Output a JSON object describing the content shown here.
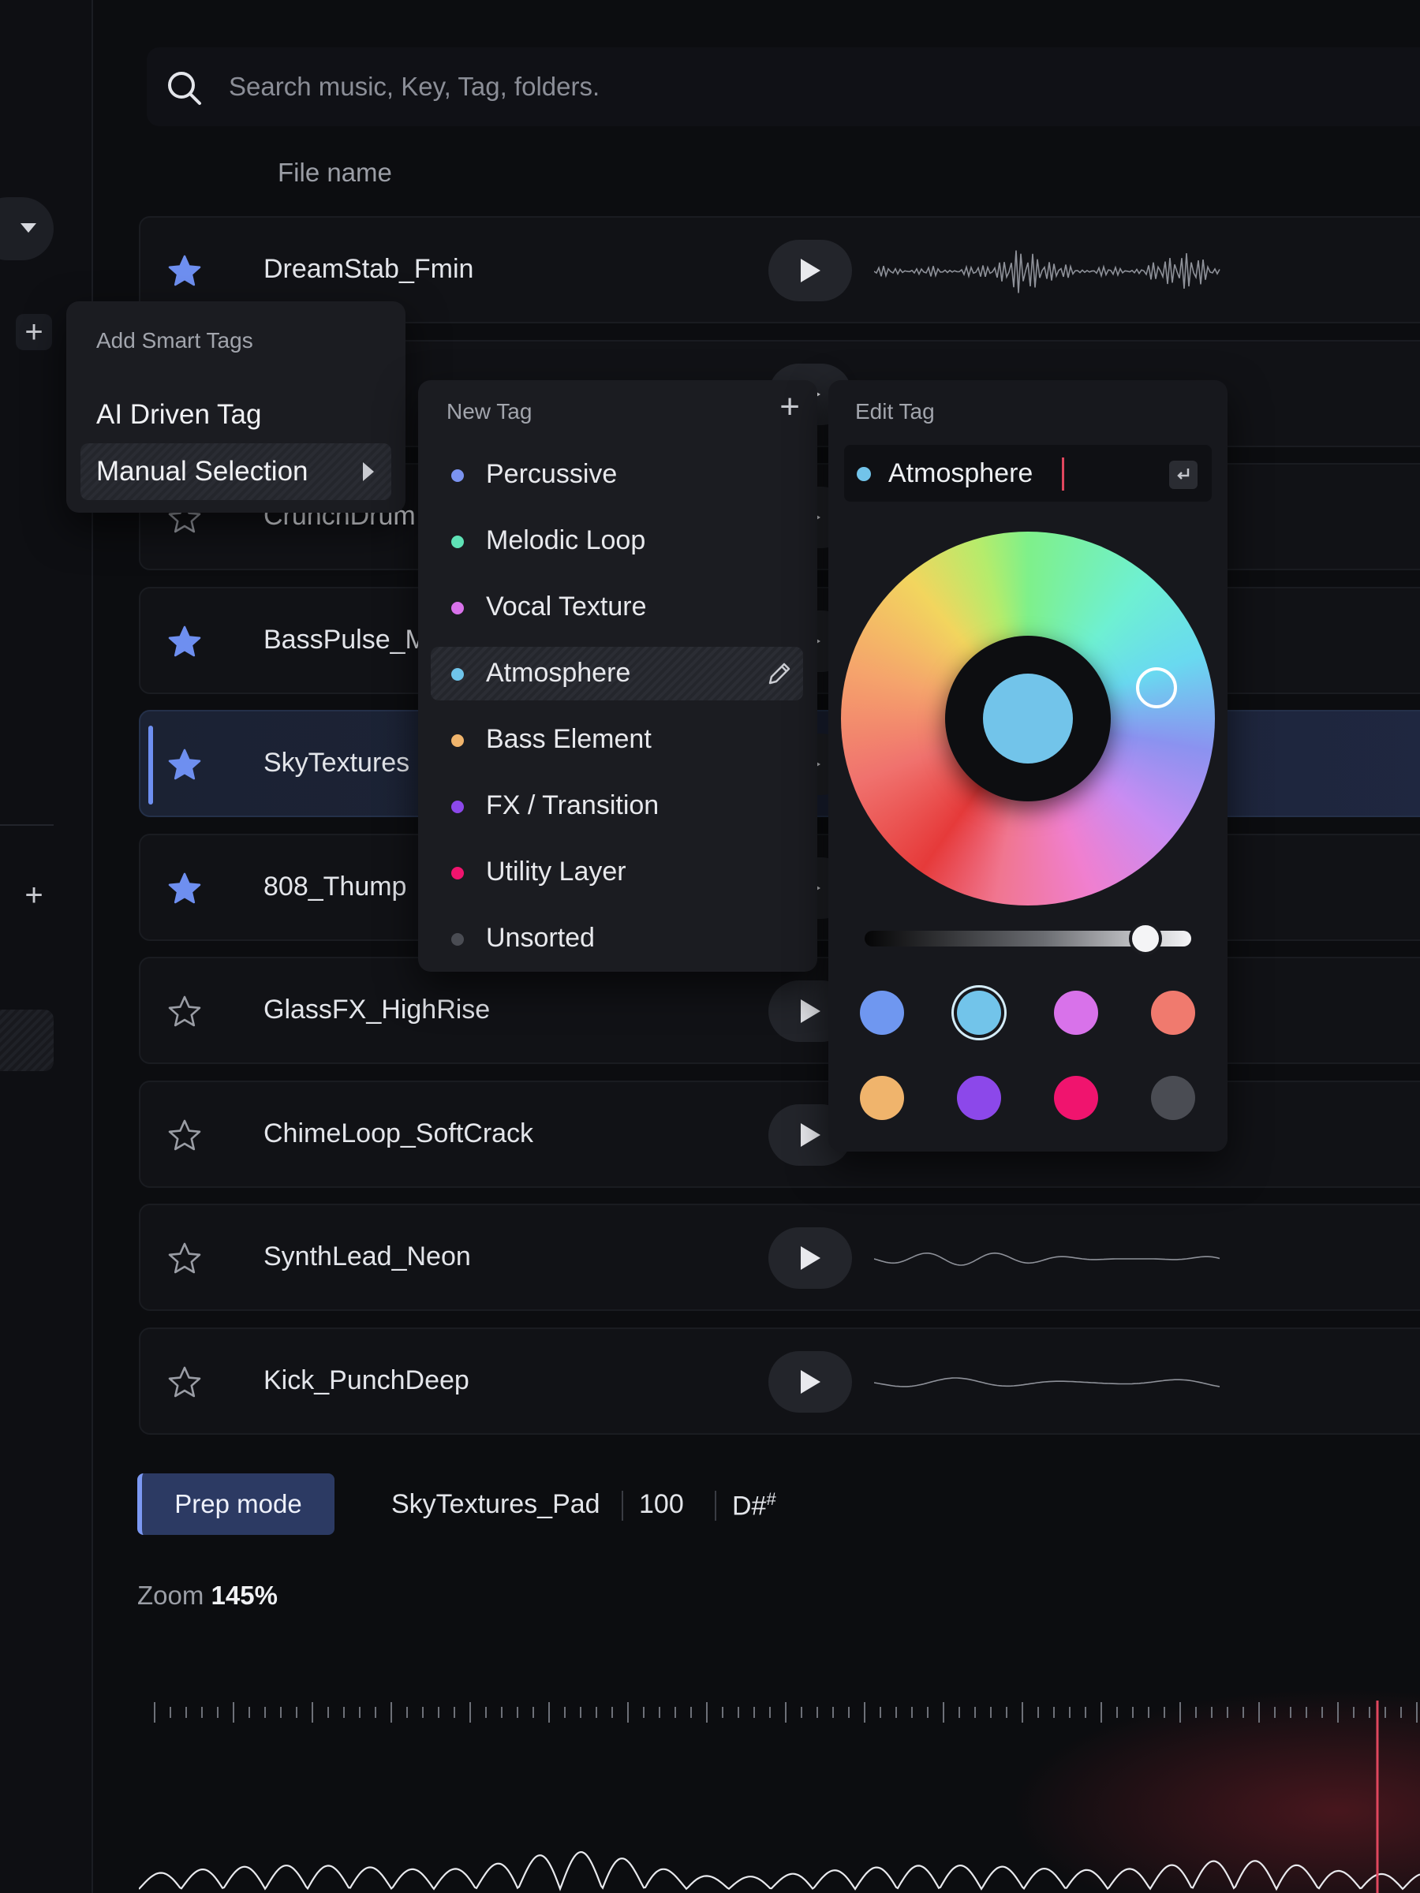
{
  "search": {
    "placeholder": "Search music, Key, Tag, folders."
  },
  "list": {
    "column_file_name": "File name",
    "rows": [
      {
        "name": "DreamStab_Fmin",
        "starred": true
      },
      {
        "name": "",
        "starred": false
      },
      {
        "name": "CrunchDrum",
        "starred": false
      },
      {
        "name": "BassPulse_M",
        "starred": true
      },
      {
        "name": "SkyTextures",
        "starred": true,
        "selected": true
      },
      {
        "name": "808_Thump",
        "starred": true
      },
      {
        "name": "GlassFX_HighRise",
        "starred": false
      },
      {
        "name": "ChimeLoop_SoftCrack",
        "starred": false
      },
      {
        "name": "SynthLead_Neon",
        "starred": false
      },
      {
        "name": "Kick_PunchDeep",
        "starred": false
      }
    ]
  },
  "smart_tags": {
    "title": "Add Smart Tags",
    "option_ai": "AI Driven Tag",
    "option_manual": "Manual Selection"
  },
  "new_tag": {
    "title": "New Tag",
    "items": [
      {
        "label": "Percussive",
        "color": "#7b93f0"
      },
      {
        "label": "Melodic Loop",
        "color": "#5fe2b6"
      },
      {
        "label": "Vocal Texture",
        "color": "#d872ea"
      },
      {
        "label": "Atmosphere",
        "color": "#6fc4ea",
        "active": true
      },
      {
        "label": "Bass Element",
        "color": "#f0b46c"
      },
      {
        "label": "FX / Transition",
        "color": "#8c48ea"
      },
      {
        "label": "Utility Layer",
        "color": "#f0146e"
      },
      {
        "label": "Unsorted",
        "color": "#4a4c53"
      }
    ]
  },
  "edit_tag": {
    "title": "Edit Tag",
    "value": "Atmosphere",
    "color": "#72c4ea",
    "brightness": 0.86,
    "swatches": [
      {
        "color": "#6f97f0"
      },
      {
        "color": "#72c4ea",
        "selected": true
      },
      {
        "color": "#d872ea"
      },
      {
        "color": "#f07a6e"
      },
      {
        "color": "#f0b46c"
      },
      {
        "color": "#8c48ea"
      },
      {
        "color": "#f0146e"
      },
      {
        "color": "#4a4c53"
      }
    ]
  },
  "bottom": {
    "prep_mode_label": "Prep mode",
    "current_file": "SkyTextures_Pad",
    "bpm": "100",
    "key": "D#",
    "key_suffix": "#",
    "zoom_label": "Zoom",
    "zoom_value": "145%"
  },
  "colors": {
    "accent": "#6e8ff0",
    "playhead": "#e0475e"
  }
}
